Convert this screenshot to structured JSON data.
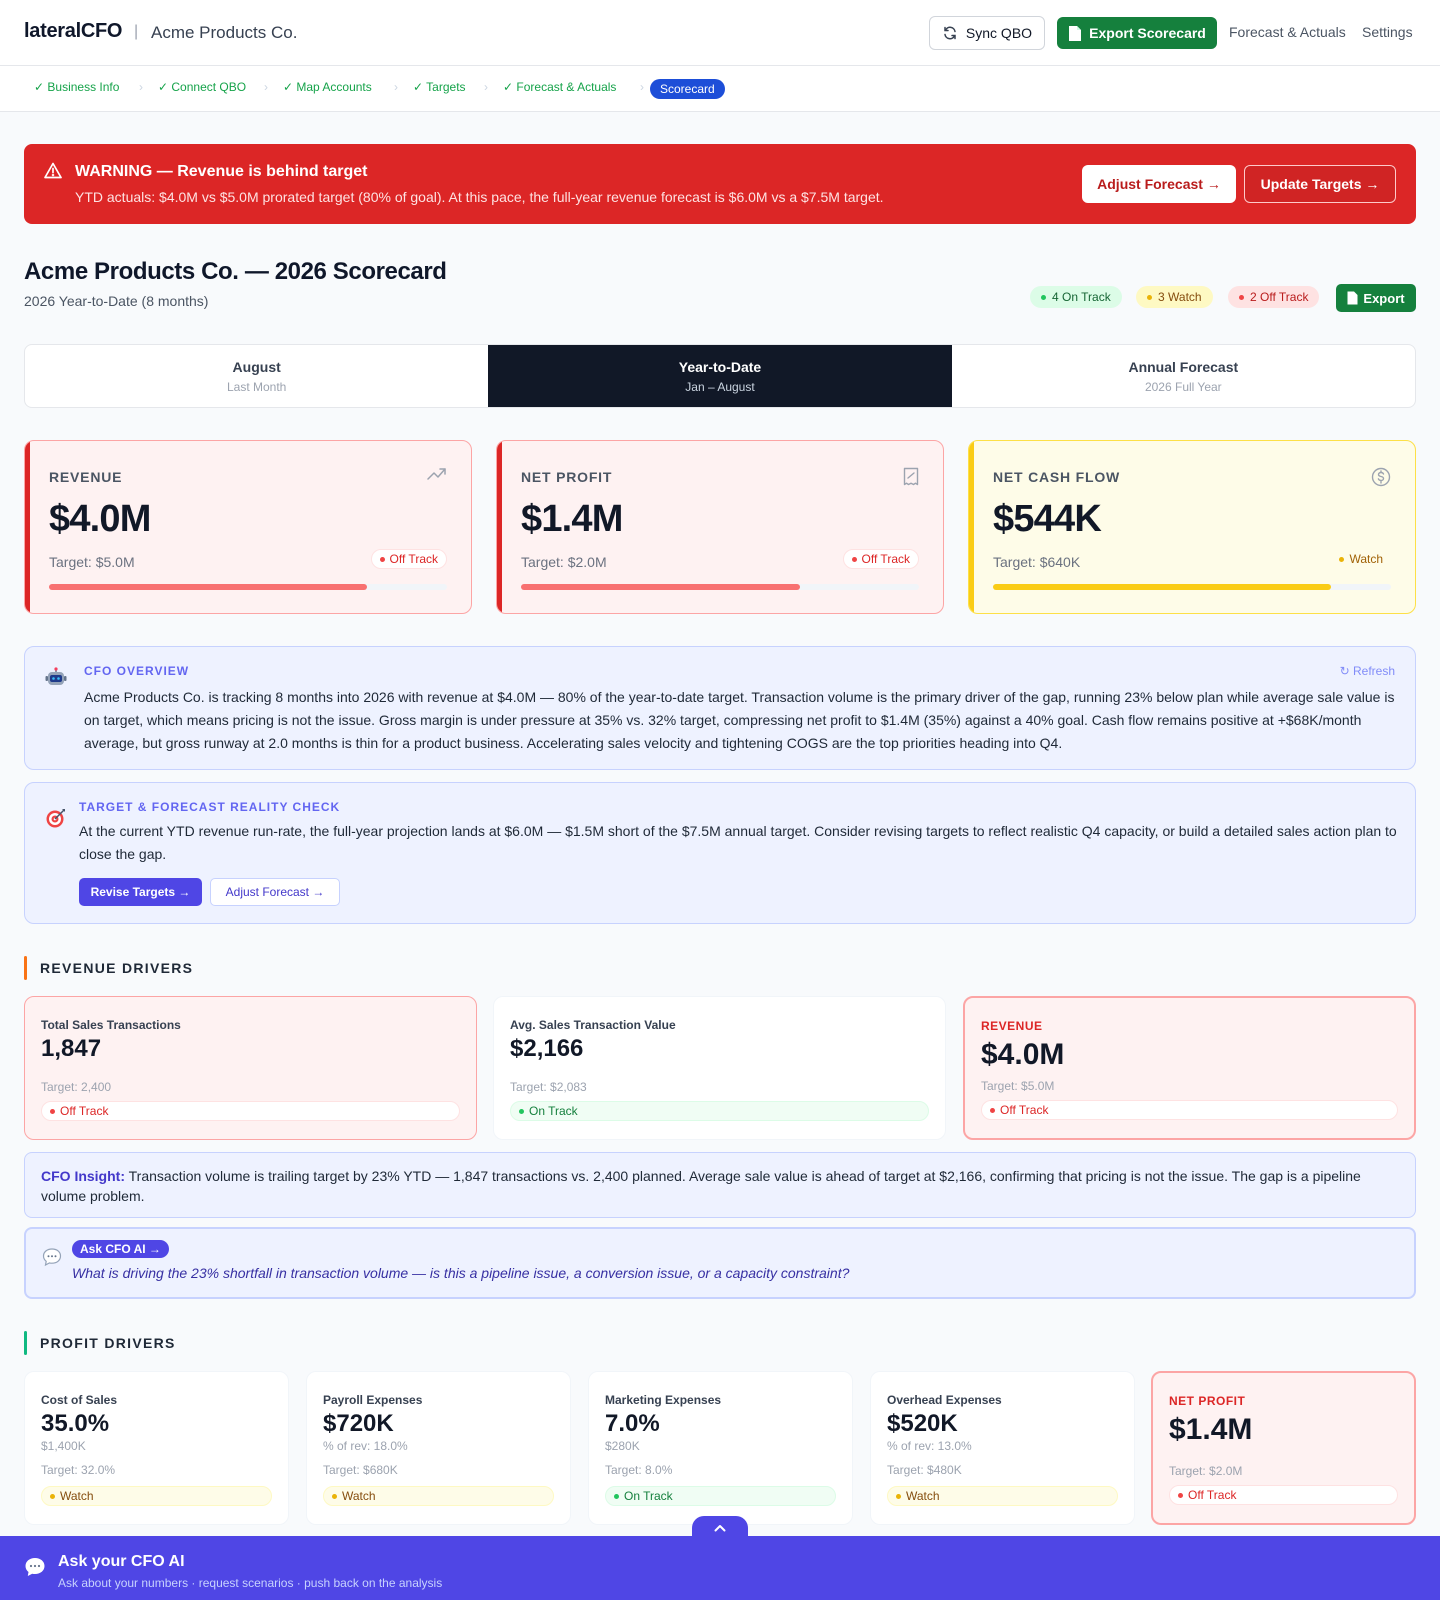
{
  "header": {
    "brand": "lateralCFO",
    "separator": "|",
    "company": "Acme Products Co.",
    "sync_label": "Sync QBO",
    "export_label": "Export Scorecard",
    "nav": [
      "Forecast & Actuals",
      "Settings"
    ]
  },
  "steps": {
    "completed": [
      "✓ Business Info",
      "✓ Connect QBO",
      "✓ Map Accounts",
      "✓ Targets",
      "✓ Forecast & Actuals"
    ],
    "separator": "›",
    "active": "Scorecard"
  },
  "alert": {
    "title": "WARNING — Revenue is behind target",
    "text": "YTD actuals: $4.0M vs $5.0M prorated target (80% of goal). At this pace, the full-year revenue forecast is $6.0M vs a $7.5M target.",
    "btn_adjust": "Adjust Forecast →",
    "btn_update": "Update Targets →"
  },
  "page": {
    "title": "Acme Products Co. — 2026 Scorecard",
    "subtitle": "2026 Year-to-Date (8 months)",
    "summary": {
      "on_track": "4 On Track",
      "watch": "3 Watch",
      "off_track": "2 Off Track",
      "export": "Export"
    }
  },
  "tabs": [
    {
      "title": "August",
      "sub": "Last Month"
    },
    {
      "title": "Year-to-Date",
      "sub": "Jan – August"
    },
    {
      "title": "Annual Forecast",
      "sub": "2026 Full Year"
    }
  ],
  "kpis": [
    {
      "label": "REVENUE",
      "value": "$4.0M",
      "target": "Target: $5.0M",
      "status": "Off Track",
      "progress_pct": 80
    },
    {
      "label": "NET PROFIT",
      "value": "$1.4M",
      "target": "Target: $2.0M",
      "status": "Off Track",
      "progress_pct": 70
    },
    {
      "label": "NET CASH FLOW",
      "value": "$544K",
      "target": "Target: $640K",
      "status": "Watch",
      "progress_pct": 85
    }
  ],
  "overview": {
    "heading": "CFO OVERVIEW",
    "refresh": "↻ Refresh",
    "body": "Acme Products Co. is tracking 8 months into 2026 with revenue at $4.0M — 80% of the year-to-date target. Transaction volume is the primary driver of the gap, running 23% below plan while average sale value is on target, which means pricing is not the issue. Gross margin is under pressure at 35% vs. 32% target, compressing net profit to $1.4M (35%) against a 40% goal. Cash flow remains positive at +$68K/month average, but gross runway at 2.0 months is thin for a product business. Accelerating sales velocity and tightening COGS are the top priorities heading into Q4."
  },
  "reality": {
    "heading": "TARGET & FORECAST REALITY CHECK",
    "body": "At the current YTD revenue run-rate, the full-year projection lands at $6.0M — $1.5M short of the $7.5M annual target. Consider revising targets to reflect realistic Q4 capacity, or build a detailed sales action plan to close the gap.",
    "btn_revise": "Revise Targets →",
    "btn_adjust": "Adjust Forecast →"
  },
  "revenue_drivers": {
    "heading": "REVENUE DRIVERS",
    "cards": [
      {
        "label": "Total Sales Transactions",
        "value": "1,847",
        "target": "Target: 2,400",
        "status": "Off Track"
      },
      {
        "label": "Avg. Sales Transaction Value",
        "value": "$2,166",
        "target": "Target: $2,083",
        "status": "On Track"
      },
      {
        "label": "REVENUE",
        "value": "$4.0M",
        "target": "Target: $5.0M",
        "status": "Off Track"
      }
    ],
    "insight_key": "CFO Insight:",
    "insight_text": " Transaction volume is trailing target by 23% YTD — 1,847 transactions vs. 2,400 planned. Average sale value is ahead of target at $2,166, confirming that pricing is not the issue. The gap is a pipeline volume problem.",
    "ask_chip": "Ask CFO AI →",
    "ask_question": "What is driving the 23% shortfall in transaction volume — is this a pipeline issue, a conversion issue, or a capacity constraint?"
  },
  "profit_drivers": {
    "heading": "PROFIT DRIVERS",
    "cards": [
      {
        "label": "Cost of Sales",
        "value": "35.0%",
        "sub": "$1,400K",
        "target": "Target: 32.0%",
        "status": "Watch"
      },
      {
        "label": "Payroll Expenses",
        "value": "$720K",
        "sub": "% of rev: 18.0%",
        "target": "Target: $680K",
        "status": "Watch"
      },
      {
        "label": "Marketing Expenses",
        "value": "7.0%",
        "sub": "$280K",
        "target": "Target: 8.0%",
        "status": "On Track"
      },
      {
        "label": "Overhead Expenses",
        "value": "$520K",
        "sub": "% of rev: 13.0%",
        "target": "Target: $480K",
        "status": "Watch"
      },
      {
        "label": "NET PROFIT",
        "value": "$1.4M",
        "target": "Target: $2.0M",
        "status": "Off Track"
      }
    ]
  },
  "footer": {
    "title": "Ask your CFO AI",
    "subtitle": "Ask about your numbers · request scenarios · push back on the analysis"
  },
  "colors": {
    "brand_green": "#15803d",
    "alert_red": "#dc2626",
    "active_step": "#1d4ed8",
    "indigo": "#4f46e5",
    "watch_yellow": "#facc15",
    "dark_tab": "#111827"
  }
}
